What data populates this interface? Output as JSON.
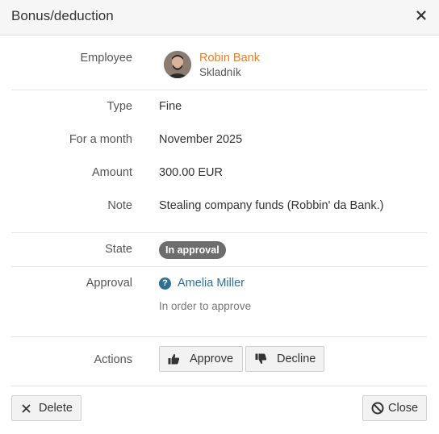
{
  "dialog": {
    "title": "Bonus/deduction"
  },
  "employee": {
    "label": "Employee",
    "name": "Robin Bank",
    "role": "Skladník"
  },
  "fields": {
    "type": {
      "label": "Type",
      "value": "Fine"
    },
    "month": {
      "label": "For a month",
      "value": "November 2025"
    },
    "amount": {
      "label": "Amount",
      "value": "300.00 EUR"
    },
    "note": {
      "label": "Note",
      "value": "Stealing company funds (Robbin' da Bank.)"
    }
  },
  "state": {
    "label": "State",
    "badge": "In approval",
    "badge_color": "#6d6d6d"
  },
  "approval": {
    "label": "Approval",
    "approver": "Amelia Miller",
    "status_icon": "question-circle-icon",
    "subtext": "In order to approve"
  },
  "actions": {
    "label": "Actions",
    "approve": "Approve",
    "decline": "Decline"
  },
  "footer": {
    "delete": "Delete",
    "close": "Close"
  },
  "colors": {
    "link": "#2f6f91",
    "employee_link": "#e67e22",
    "header_bg": "#f6f6f6"
  }
}
